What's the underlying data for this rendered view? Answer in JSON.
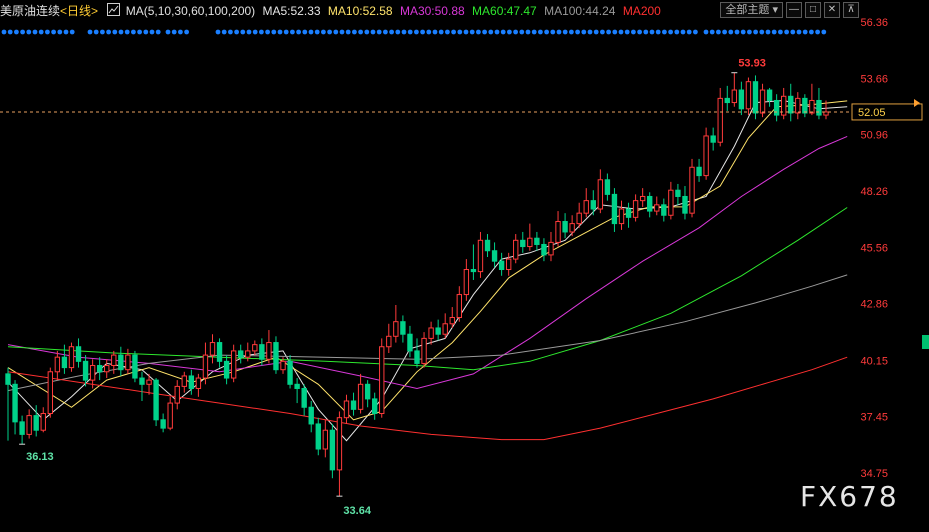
{
  "header": {
    "symbol": "美原油连续",
    "period": "<日线>",
    "ma_params": "MA(5,10,30,60,100,200)",
    "ma5": "MA5:52.33",
    "ma10": "MA10:52.58",
    "ma30": "MA30:50.88",
    "ma60": "MA60:47.47",
    "ma100": "MA100:44.24",
    "ma200": "MA200"
  },
  "toolbar": {
    "theme_label": "全部主题",
    "theme_icon": "chevron-down-icon",
    "buttons": [
      "minimize-icon",
      "restore-icon",
      "close-icon",
      "pin-icon"
    ]
  },
  "watermark": "FX678",
  "last_price_label": "52.05",
  "colors": {
    "up": "#ff3b3b",
    "down": "#00d28a",
    "ma5": "#e6e6e6",
    "ma10": "#ffe36b",
    "ma30": "#d838d8",
    "ma60": "#2ee82e",
    "ma100": "#9a9a9a",
    "ma200": "#ff3030",
    "axis_text": "#ff3b3b",
    "marker_dots": "#1a7fff"
  },
  "chart_data": {
    "type": "candlestick",
    "y_axis_ticks": [
      "56.36",
      "53.66",
      "50.96",
      "48.26",
      "45.56",
      "42.86",
      "40.15",
      "37.45",
      "34.75"
    ],
    "ylim": [
      34.75,
      56.36
    ],
    "last_price": 52.05,
    "annotations": [
      {
        "text": "53.93",
        "value": 53.93,
        "kind": "high"
      },
      {
        "text": "36.13",
        "value": 36.13,
        "kind": "low"
      },
      {
        "text": "33.64",
        "value": 33.64,
        "kind": "low"
      }
    ],
    "candles": [
      [
        39.5,
        39.0,
        39.8,
        36.3
      ],
      [
        39.0,
        37.2,
        39.2,
        36.6
      ],
      [
        37.2,
        36.6,
        37.5,
        36.13
      ],
      [
        36.6,
        37.5,
        37.8,
        36.4
      ],
      [
        37.5,
        36.8,
        38.0,
        36.5
      ],
      [
        36.8,
        37.6,
        37.9,
        36.7
      ],
      [
        37.6,
        39.6,
        39.8,
        37.4
      ],
      [
        39.6,
        40.3,
        40.6,
        39.2
      ],
      [
        40.3,
        39.8,
        40.9,
        39.5
      ],
      [
        39.8,
        40.8,
        41.0,
        39.6
      ],
      [
        40.8,
        40.1,
        41.2,
        39.8
      ],
      [
        40.1,
        39.2,
        40.4,
        38.9
      ],
      [
        39.2,
        39.9,
        40.2,
        38.8
      ],
      [
        39.9,
        39.6,
        40.3,
        39.2
      ],
      [
        39.6,
        39.9,
        40.2,
        39.3
      ],
      [
        39.9,
        40.4,
        40.6,
        39.5
      ],
      [
        40.4,
        39.7,
        40.8,
        39.4
      ],
      [
        39.7,
        40.4,
        40.7,
        39.5
      ],
      [
        40.4,
        39.3,
        40.6,
        39.1
      ],
      [
        39.3,
        39.0,
        39.6,
        38.2
      ],
      [
        39.0,
        39.2,
        39.5,
        38.5
      ],
      [
        39.2,
        37.3,
        39.3,
        37.0
      ],
      [
        37.3,
        36.9,
        37.6,
        36.7
      ],
      [
        36.9,
        38.1,
        38.4,
        36.8
      ],
      [
        38.1,
        38.9,
        39.2,
        37.8
      ],
      [
        38.9,
        39.4,
        39.6,
        38.6
      ],
      [
        39.4,
        38.8,
        39.7,
        38.5
      ],
      [
        38.8,
        39.3,
        39.5,
        38.4
      ],
      [
        39.3,
        40.4,
        41.0,
        39.0
      ],
      [
        40.4,
        41.0,
        41.4,
        40.0
      ],
      [
        41.0,
        40.1,
        41.2,
        39.8
      ],
      [
        40.1,
        39.3,
        40.4,
        39.0
      ],
      [
        39.3,
        40.6,
        40.9,
        39.1
      ],
      [
        40.6,
        40.3,
        40.9,
        40.0
      ],
      [
        40.3,
        40.6,
        41.0,
        40.1
      ],
      [
        40.6,
        40.9,
        41.1,
        40.4
      ],
      [
        40.9,
        40.2,
        41.2,
        39.9
      ],
      [
        40.2,
        41.0,
        41.6,
        40.0
      ],
      [
        41.0,
        39.7,
        41.3,
        39.5
      ],
      [
        39.7,
        40.1,
        40.3,
        39.5
      ],
      [
        40.1,
        39.0,
        40.4,
        38.8
      ],
      [
        39.0,
        38.8,
        39.3,
        38.1
      ],
      [
        38.8,
        37.9,
        39.0,
        37.5
      ],
      [
        37.9,
        37.1,
        38.2,
        36.7
      ],
      [
        37.1,
        35.9,
        37.4,
        35.6
      ],
      [
        35.9,
        36.8,
        37.3,
        35.5
      ],
      [
        36.8,
        34.9,
        37.1,
        34.5
      ],
      [
        34.9,
        37.4,
        37.7,
        33.64
      ],
      [
        37.4,
        38.2,
        38.5,
        37.1
      ],
      [
        38.2,
        37.8,
        38.6,
        37.5
      ],
      [
        37.8,
        39.0,
        39.5,
        37.6
      ],
      [
        39.0,
        38.3,
        39.2,
        37.9
      ],
      [
        38.3,
        37.6,
        38.6,
        37.3
      ],
      [
        37.6,
        40.8,
        41.2,
        37.4
      ],
      [
        40.8,
        41.3,
        41.9,
        40.5
      ],
      [
        41.3,
        42.0,
        42.8,
        41.0
      ],
      [
        42.0,
        41.4,
        42.3,
        41.0
      ],
      [
        41.4,
        40.6,
        41.8,
        40.3
      ],
      [
        40.6,
        40.0,
        41.2,
        39.8
      ],
      [
        40.0,
        41.2,
        41.5,
        39.8
      ],
      [
        41.2,
        41.7,
        42.0,
        40.9
      ],
      [
        41.7,
        41.4,
        42.1,
        41.1
      ],
      [
        41.4,
        41.9,
        42.4,
        41.2
      ],
      [
        41.9,
        42.2,
        42.7,
        41.7
      ],
      [
        42.2,
        43.3,
        43.7,
        42.0
      ],
      [
        43.3,
        44.5,
        45.0,
        43.0
      ],
      [
        44.5,
        44.4,
        45.7,
        44.0
      ],
      [
        44.4,
        45.9,
        46.3,
        44.1
      ],
      [
        45.9,
        45.4,
        46.2,
        45.1
      ],
      [
        45.4,
        44.9,
        45.8,
        44.6
      ],
      [
        44.9,
        44.5,
        45.3,
        44.2
      ],
      [
        44.5,
        45.0,
        45.3,
        44.2
      ],
      [
        45.0,
        45.9,
        46.2,
        44.8
      ],
      [
        45.9,
        45.6,
        46.3,
        45.3
      ],
      [
        45.6,
        46.0,
        46.7,
        45.4
      ],
      [
        46.0,
        45.7,
        46.3,
        45.4
      ],
      [
        45.7,
        45.2,
        46.0,
        44.9
      ],
      [
        45.2,
        45.8,
        46.3,
        44.9
      ],
      [
        45.8,
        46.8,
        47.3,
        45.6
      ],
      [
        46.8,
        46.3,
        47.2,
        46.0
      ],
      [
        46.3,
        46.7,
        47.1,
        46.1
      ],
      [
        46.7,
        47.2,
        47.7,
        46.5
      ],
      [
        47.2,
        47.8,
        48.4,
        47.0
      ],
      [
        47.8,
        47.4,
        48.3,
        47.1
      ],
      [
        47.4,
        48.8,
        49.3,
        47.2
      ],
      [
        48.8,
        48.1,
        49.1,
        47.8
      ],
      [
        48.1,
        46.7,
        48.4,
        46.3
      ],
      [
        46.7,
        47.4,
        47.8,
        46.4
      ],
      [
        47.4,
        47.0,
        47.7,
        46.5
      ],
      [
        47.0,
        47.8,
        48.1,
        46.8
      ],
      [
        47.8,
        48.0,
        48.4,
        47.5
      ],
      [
        48.0,
        47.3,
        48.2,
        47.0
      ],
      [
        47.3,
        47.6,
        48.0,
        47.1
      ],
      [
        47.6,
        47.1,
        47.9,
        46.8
      ],
      [
        47.1,
        48.3,
        48.7,
        46.9
      ],
      [
        48.3,
        48.0,
        48.6,
        47.6
      ],
      [
        48.0,
        47.2,
        48.5,
        46.9
      ],
      [
        47.2,
        49.4,
        49.8,
        47.0
      ],
      [
        49.4,
        49.0,
        49.8,
        48.7
      ],
      [
        49.0,
        50.9,
        51.3,
        48.8
      ],
      [
        50.9,
        50.6,
        51.3,
        50.2
      ],
      [
        50.6,
        52.7,
        53.2,
        50.4
      ],
      [
        52.7,
        52.5,
        53.3,
        52.1
      ],
      [
        52.5,
        53.1,
        53.93,
        52.3
      ],
      [
        53.1,
        52.2,
        53.5,
        51.9
      ],
      [
        52.2,
        53.5,
        53.7,
        51.9
      ],
      [
        53.5,
        52.0,
        53.8,
        51.7
      ],
      [
        52.0,
        53.1,
        53.4,
        51.8
      ],
      [
        53.1,
        52.6,
        53.2,
        52.3
      ],
      [
        52.6,
        51.9,
        52.9,
        51.6
      ],
      [
        51.9,
        52.8,
        53.2,
        51.7
      ],
      [
        52.8,
        52.0,
        53.4,
        51.6
      ],
      [
        52.0,
        52.7,
        53.0,
        51.7
      ],
      [
        52.7,
        52.0,
        52.9,
        51.8
      ],
      [
        52.0,
        52.6,
        53.4,
        51.9
      ],
      [
        52.6,
        51.9,
        53.2,
        51.7
      ],
      [
        51.9,
        52.05,
        52.6,
        51.7
      ]
    ],
    "ma_series": [
      {
        "name": "MA5",
        "values": [
          [
            0,
            39.1
          ],
          [
            5,
            37.3
          ],
          [
            9,
            38.4
          ],
          [
            14,
            40.0
          ],
          [
            19,
            39.7
          ],
          [
            24,
            38.2
          ],
          [
            29,
            39.6
          ],
          [
            34,
            40.4
          ],
          [
            39,
            40.6
          ],
          [
            44,
            37.8
          ],
          [
            48,
            36.3
          ],
          [
            53,
            38.3
          ],
          [
            57,
            40.7
          ],
          [
            62,
            41.2
          ],
          [
            66,
            43.3
          ],
          [
            70,
            45.0
          ],
          [
            74,
            45.3
          ],
          [
            79,
            45.9
          ],
          [
            84,
            47.6
          ],
          [
            89,
            47.4
          ],
          [
            94,
            47.5
          ],
          [
            99,
            48.0
          ],
          [
            103,
            50.4
          ],
          [
            106,
            52.5
          ],
          [
            110,
            52.6
          ],
          [
            115,
            52.2
          ],
          [
            119,
            52.3
          ]
        ]
      },
      {
        "name": "MA10",
        "values": [
          [
            0,
            39.8
          ],
          [
            9,
            37.9
          ],
          [
            14,
            39.2
          ],
          [
            20,
            39.8
          ],
          [
            26,
            39.1
          ],
          [
            32,
            39.6
          ],
          [
            38,
            40.3
          ],
          [
            44,
            39.0
          ],
          [
            49,
            37.3
          ],
          [
            53,
            37.7
          ],
          [
            58,
            39.6
          ],
          [
            63,
            41.0
          ],
          [
            67,
            42.5
          ],
          [
            71,
            44.1
          ],
          [
            76,
            45.2
          ],
          [
            81,
            46.1
          ],
          [
            86,
            47.0
          ],
          [
            91,
            47.5
          ],
          [
            96,
            47.5
          ],
          [
            101,
            48.5
          ],
          [
            105,
            50.8
          ],
          [
            109,
            52.3
          ],
          [
            114,
            52.4
          ],
          [
            119,
            52.58
          ]
        ]
      },
      {
        "name": "MA30",
        "values": [
          [
            0,
            40.9
          ],
          [
            10,
            40.3
          ],
          [
            20,
            40.0
          ],
          [
            30,
            39.6
          ],
          [
            40,
            40.1
          ],
          [
            50,
            39.4
          ],
          [
            58,
            38.8
          ],
          [
            66,
            39.5
          ],
          [
            74,
            41.2
          ],
          [
            82,
            43.1
          ],
          [
            90,
            44.9
          ],
          [
            98,
            46.5
          ],
          [
            104,
            48.0
          ],
          [
            110,
            49.3
          ],
          [
            115,
            50.3
          ],
          [
            119,
            50.88
          ]
        ]
      },
      {
        "name": "MA60",
        "values": [
          [
            0,
            40.8
          ],
          [
            15,
            40.5
          ],
          [
            30,
            40.3
          ],
          [
            45,
            40.1
          ],
          [
            58,
            39.9
          ],
          [
            66,
            39.7
          ],
          [
            74,
            40.1
          ],
          [
            84,
            41.1
          ],
          [
            94,
            42.4
          ],
          [
            104,
            44.2
          ],
          [
            112,
            45.9
          ],
          [
            119,
            47.47
          ]
        ]
      },
      {
        "name": "MA100",
        "values": [
          [
            0,
            38.7
          ],
          [
            10,
            39.4
          ],
          [
            20,
            40.0
          ],
          [
            30,
            40.4
          ],
          [
            45,
            40.3
          ],
          [
            58,
            40.2
          ],
          [
            70,
            40.4
          ],
          [
            84,
            41.1
          ],
          [
            96,
            42.0
          ],
          [
            106,
            42.9
          ],
          [
            114,
            43.7
          ],
          [
            119,
            44.24
          ]
        ]
      },
      {
        "name": "MA200",
        "values": [
          [
            0,
            39.6
          ],
          [
            10,
            39.1
          ],
          [
            20,
            38.6
          ],
          [
            30,
            38.1
          ],
          [
            40,
            37.6
          ],
          [
            50,
            37.0
          ],
          [
            60,
            36.6
          ],
          [
            70,
            36.35
          ],
          [
            76,
            36.35
          ],
          [
            84,
            36.9
          ],
          [
            92,
            37.6
          ],
          [
            100,
            38.3
          ],
          [
            108,
            39.1
          ],
          [
            114,
            39.7
          ],
          [
            119,
            40.3
          ]
        ]
      }
    ]
  }
}
